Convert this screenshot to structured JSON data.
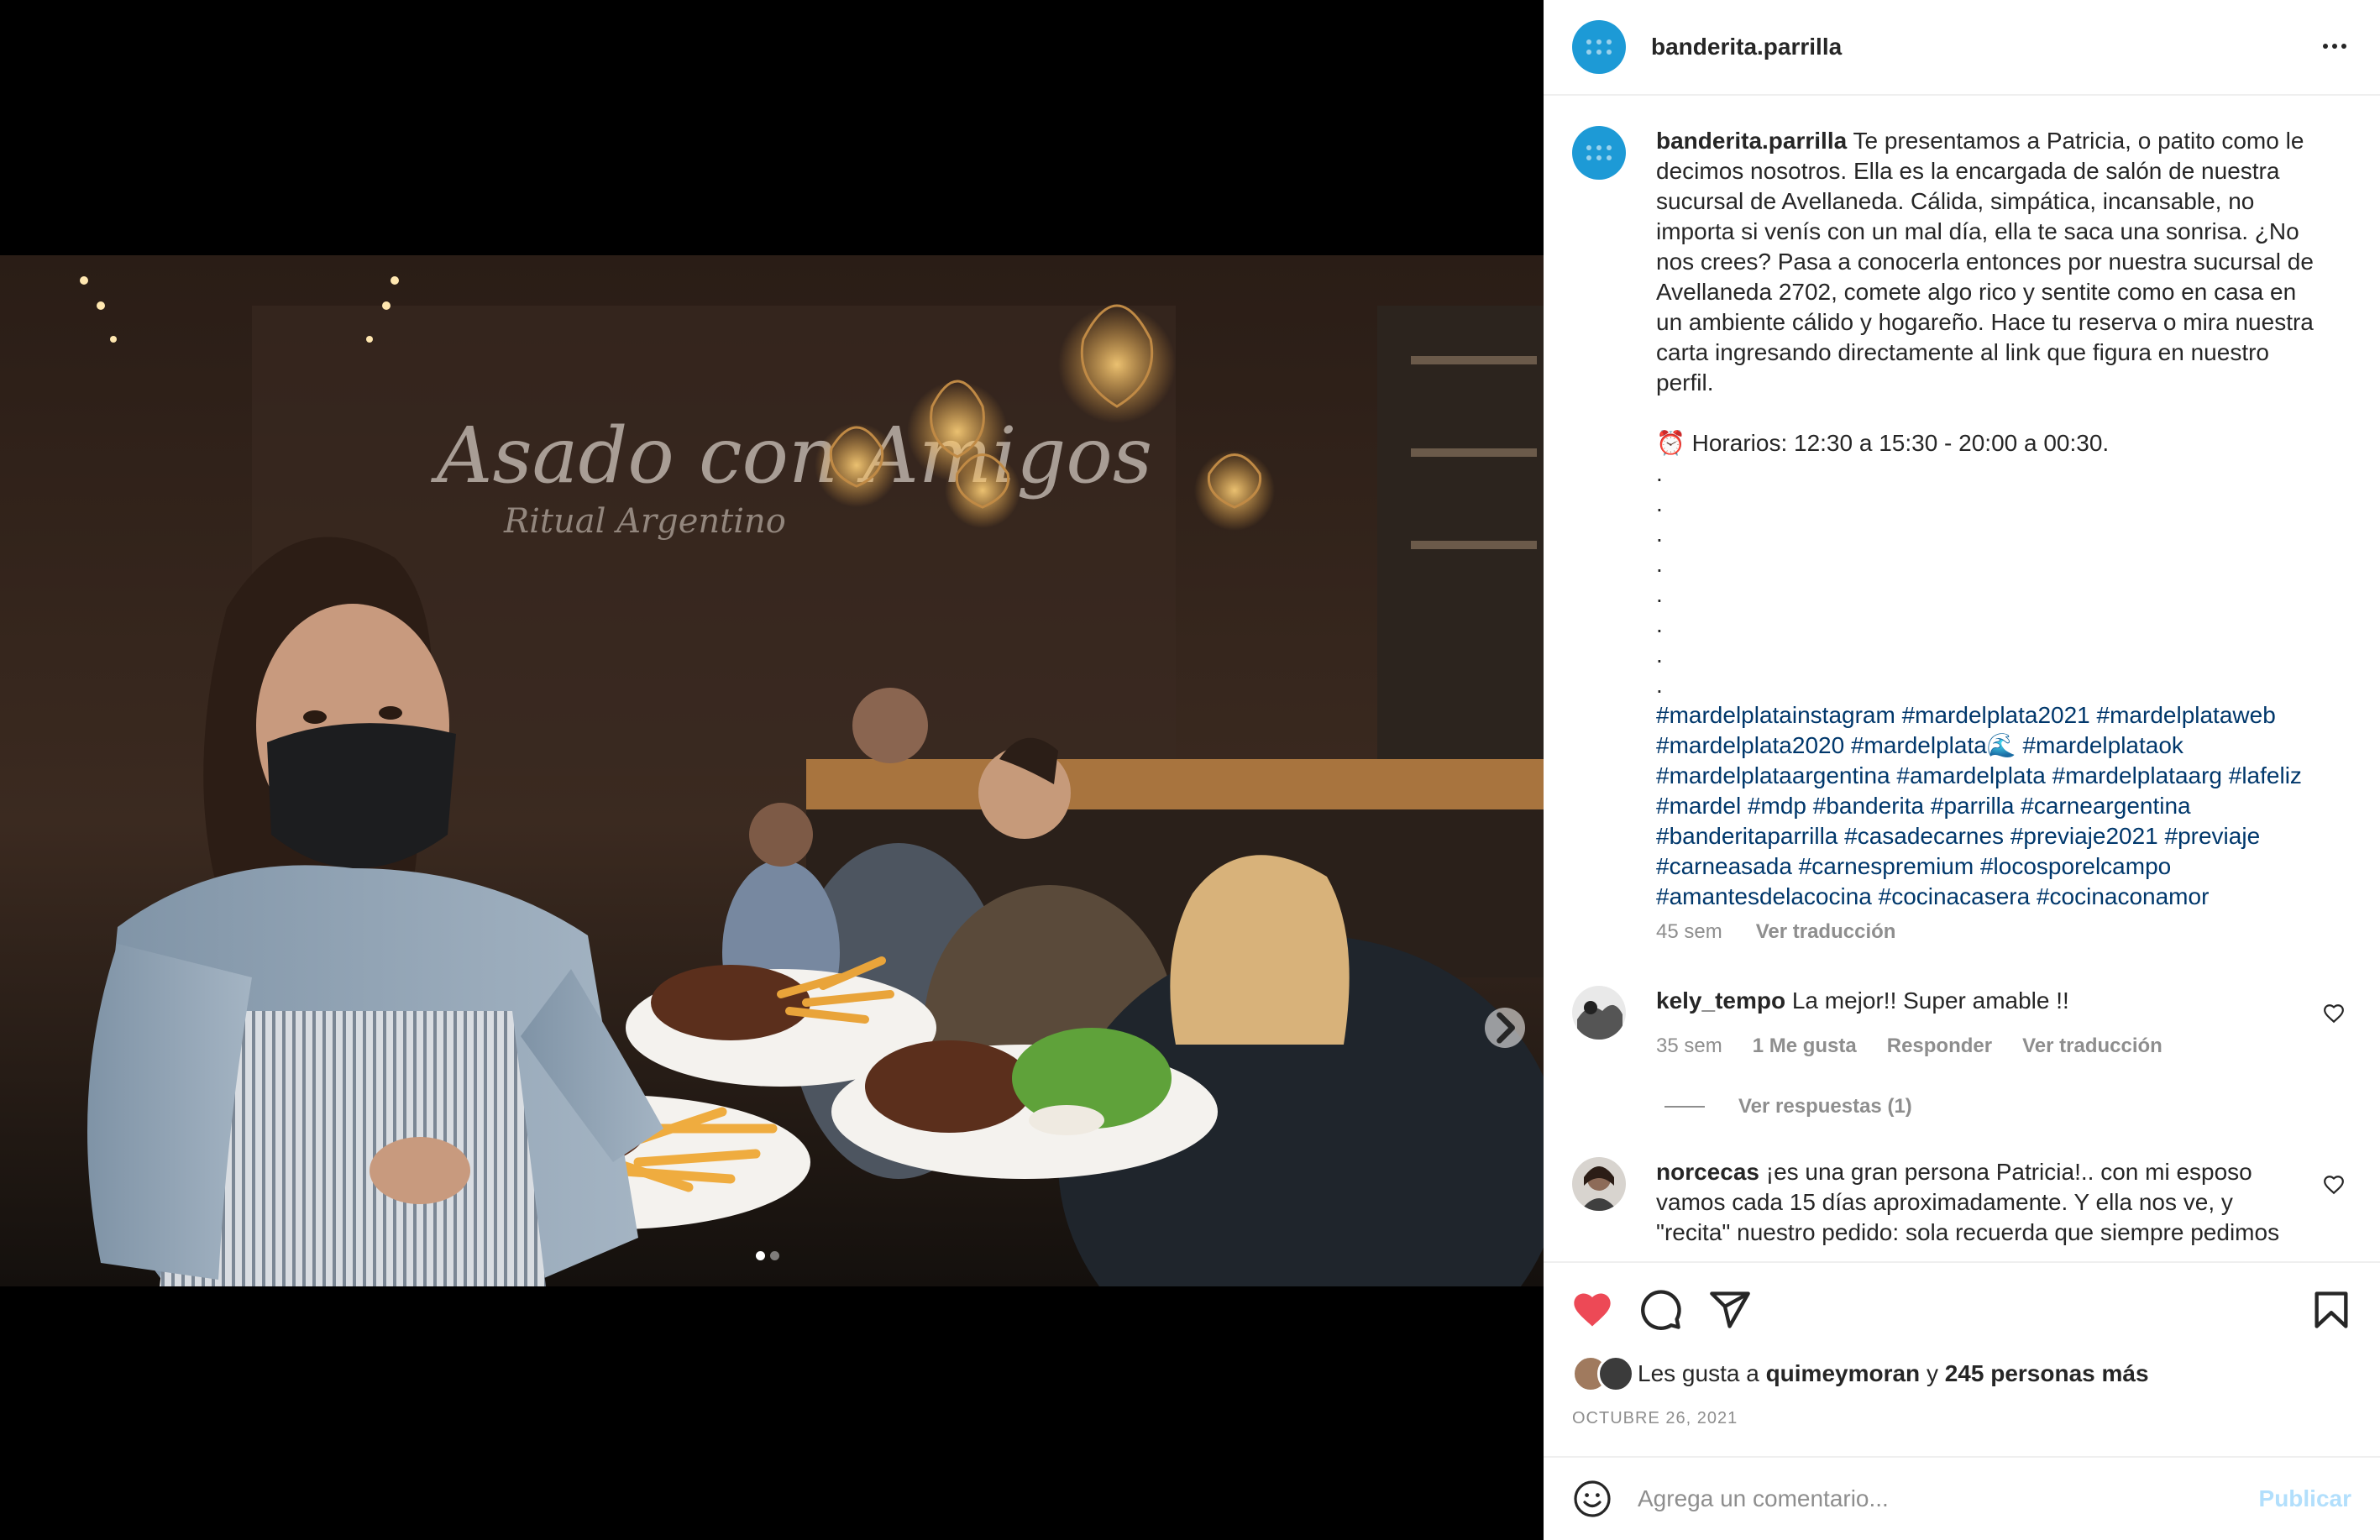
{
  "post": {
    "username": "banderita.parrilla",
    "caption_text": "Te presentamos a Patricia, o patito como le decimos nosotros. Ella es la encargada de salón de nuestra sucursal de Avellaneda. Cálida, simpática, incansable, no importa si venís con un mal día, ella te saca una sonrisa. ¿No nos crees? Pasa a conocerla entonces por nuestra sucursal de Avellaneda 2702, comete algo rico y sentite como en casa en un ambiente cálido y hogareño. Hace tu reserva o mira nuestra carta ingresando directamente al link que figura en nuestro perfil.",
    "hours": "⏰ Horarios: 12:30 a 15:30 - 20:00 a 00:30.",
    "dots": ".\n.\n.\n.\n.\n.\n.\n.",
    "hashtags": "#mardelplatainstagram #mardelplata2021 #mardelplataweb #mardelplata2020 #mardelplata🌊 #mardelplataok #mardelplataargentina #amardelplata #mardelplataarg #lafeliz #mardel #mdp #banderita #parrilla #carneargentina #banderitaparrilla #casadecarnes #previaje2021 #previaje #carneasada #carnespremium #locosporelcampo #amantesdelacocina #cocinacasera #cocinaconamor",
    "time_ago": "45 sem",
    "see_translation": "Ver traducción"
  },
  "photo": {
    "wall_text_main": "Asado con Amigos",
    "wall_text_sub": "Ritual Argentino"
  },
  "comments": [
    {
      "username": "kely_tempo",
      "text": "La mejor!! Super amable !!",
      "time": "35 sem",
      "likes": "1 Me gusta",
      "reply": "Responder",
      "translate": "Ver traducción"
    },
    {
      "username": "norcecas",
      "text": "¡es una gran persona Patricia!.. con mi esposo vamos cada 15 días aproximadamente. Y ella nos ve, y \"recita\" nuestro pedido: sola recuerda que siempre pedimos"
    }
  ],
  "view_replies": "Ver respuestas (1)",
  "likes": {
    "prefix": "Les gusta a",
    "user": "quimeymoran",
    "conj": "y",
    "others": "245 personas más"
  },
  "date": "OCTUBRE 26, 2021",
  "comment_box": {
    "placeholder": "Agrega un comentario...",
    "publish": "Publicar"
  },
  "colors": {
    "brand_avatar": "#1d9ad6",
    "liked_heart": "#ed4956",
    "hashtag": "#00376b",
    "publish_disabled": "#b2dffc"
  },
  "icons": [
    "heart-icon",
    "comment-icon",
    "share-icon",
    "save-icon",
    "emoji-icon",
    "more-options-icon",
    "chevron-right-icon"
  ],
  "carousel": {
    "current": 1,
    "total": 2
  }
}
